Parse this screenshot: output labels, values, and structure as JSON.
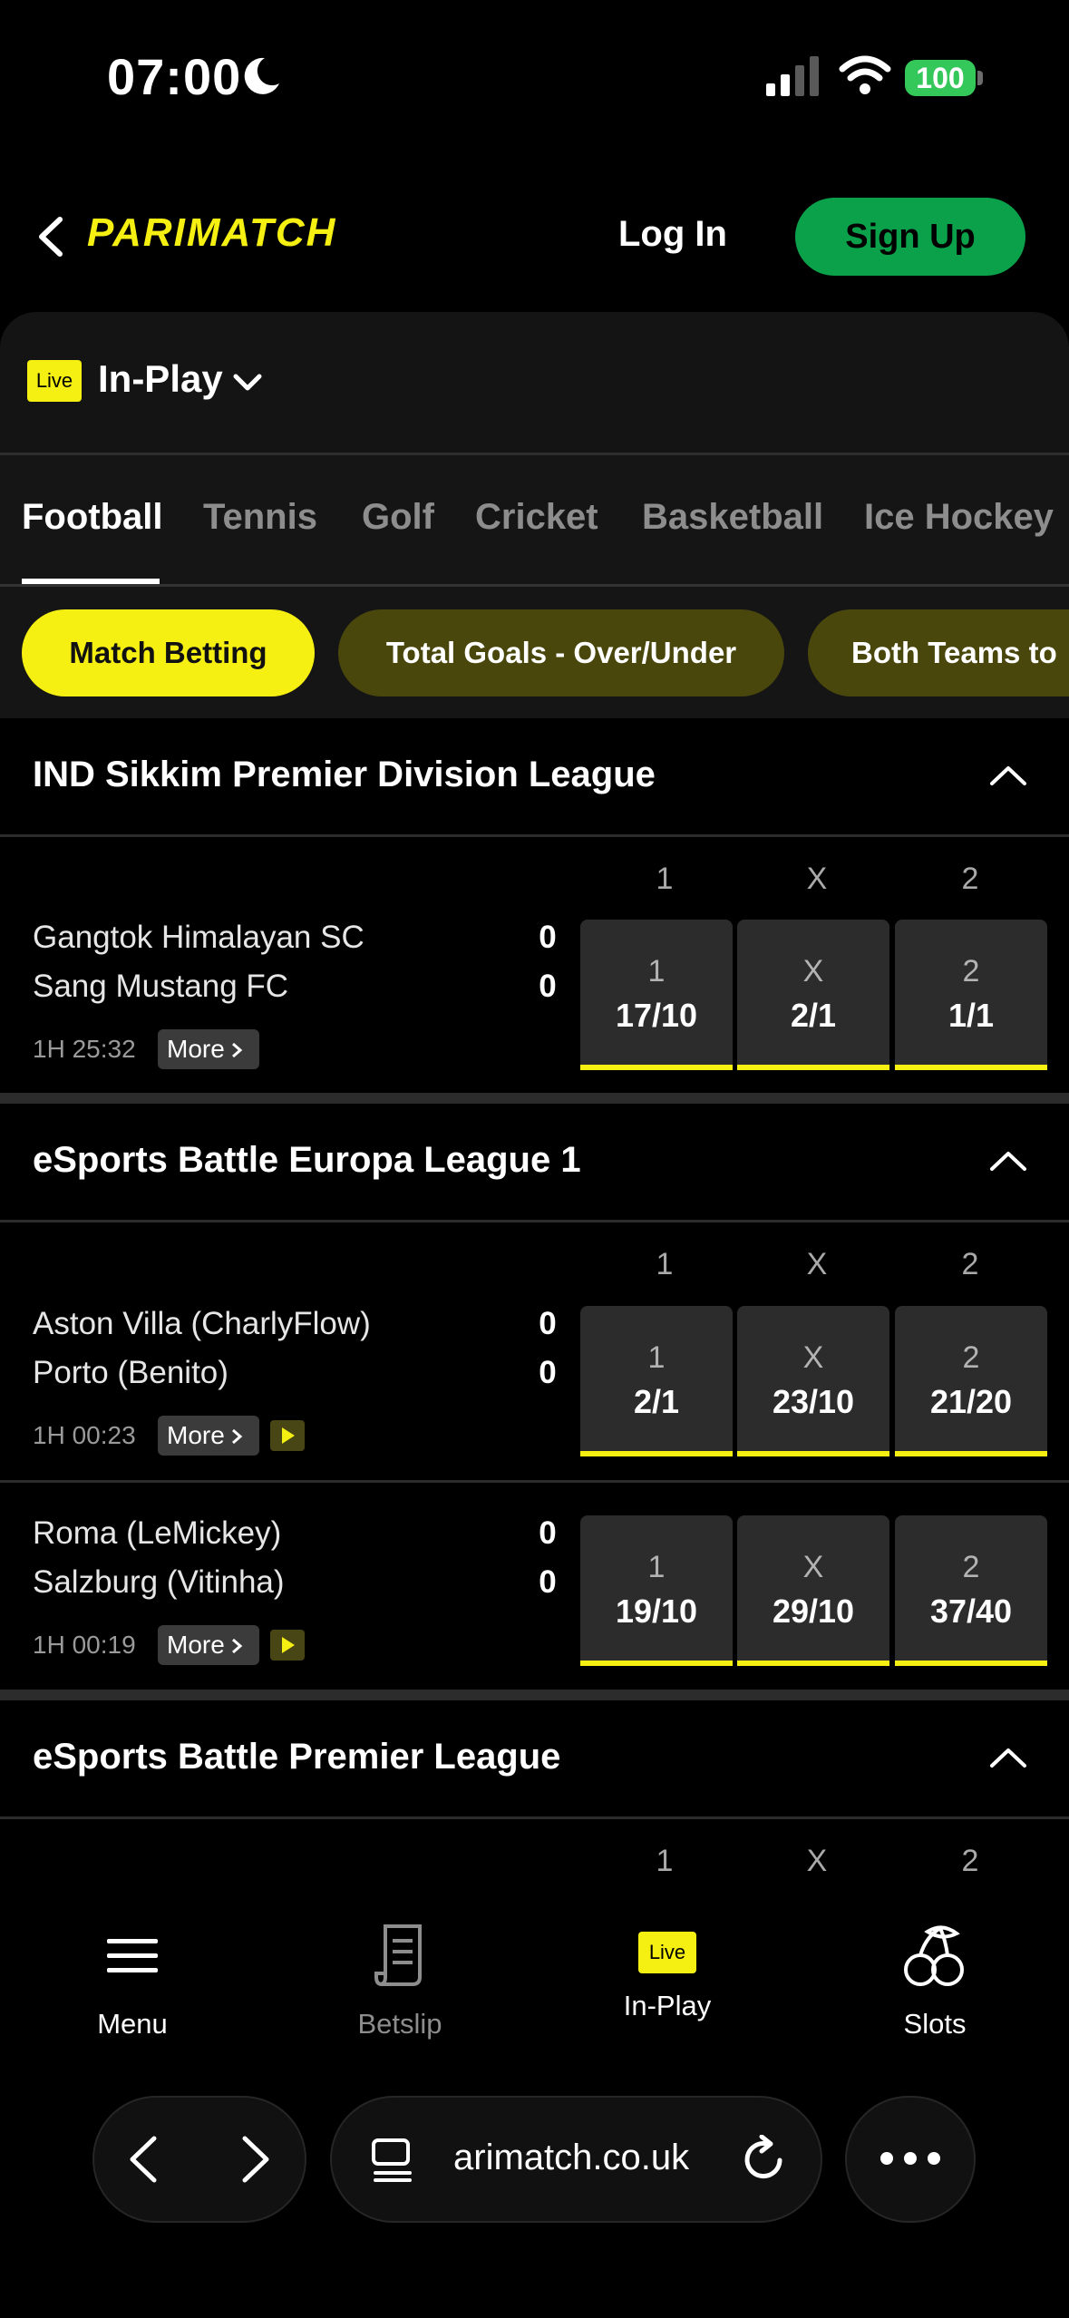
{
  "status_bar": {
    "time": "07:00",
    "battery": "100"
  },
  "header": {
    "logo": "PARIMATCH",
    "login_label": "Log In",
    "signup_label": "Sign Up"
  },
  "inplay": {
    "live_badge": "Live",
    "title": "In-Play"
  },
  "sport_tabs": [
    "Football",
    "Tennis",
    "Golf",
    "Cricket",
    "Basketball",
    "Ice Hockey"
  ],
  "market_chips": [
    "Match Betting",
    "Total Goals - Over/Under",
    "Both Teams to"
  ],
  "columns": [
    "1",
    "X",
    "2"
  ],
  "leagues": [
    {
      "title": "IND Sikkim Premier Division League",
      "matches": [
        {
          "home": "Gangtok Himalayan SC",
          "away": "Sang Mustang FC",
          "home_score": "0",
          "away_score": "0",
          "clock": "1H 25:32",
          "more": "More",
          "odds": [
            "17/10",
            "2/1",
            "1/1"
          ]
        }
      ]
    },
    {
      "title": "eSports Battle Europa League 1",
      "matches": [
        {
          "home": "Aston Villa (CharlyFlow)",
          "away": "Porto (Benito)",
          "home_score": "0",
          "away_score": "0",
          "clock": "1H 00:23",
          "more": "More",
          "odds": [
            "2/1",
            "23/10",
            "21/20"
          ]
        },
        {
          "home": "Roma (LeMickey)",
          "away": "Salzburg (Vitinha)",
          "home_score": "0",
          "away_score": "0",
          "clock": "1H 00:19",
          "more": "More",
          "odds": [
            "19/10",
            "29/10",
            "37/40"
          ]
        }
      ]
    },
    {
      "title": "eSports Battle Premier League",
      "matches": []
    }
  ],
  "bottom_nav": [
    {
      "label": "Menu",
      "icon": "menu-icon"
    },
    {
      "label": "Betslip",
      "icon": "betslip-icon"
    },
    {
      "label": "In-Play",
      "icon": "live-icon",
      "badge": "Live"
    },
    {
      "label": "Slots",
      "icon": "cherries-icon"
    }
  ],
  "browser": {
    "url": "arimatch.co.uk"
  },
  "colors": {
    "accent": "#f5ef12",
    "signup": "#0aa14a",
    "battery": "#34c759"
  }
}
